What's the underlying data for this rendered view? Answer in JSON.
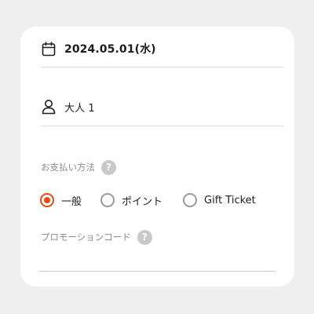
{
  "booking": {
    "date": "2024.05.01(水)",
    "date_icon": "calendar-icon",
    "guests": "大人 1",
    "guests_icon": "person-icon"
  },
  "payment": {
    "label": "お支払い方法",
    "help": "?",
    "options": [
      {
        "label": "一般",
        "selected": true
      },
      {
        "label": "ポイント",
        "selected": false
      },
      {
        "label": "Gift Ticket",
        "selected": false
      }
    ],
    "accent_color": "#ea4a14"
  },
  "promo": {
    "label": "プロモーションコード",
    "help": "?",
    "value": ""
  }
}
